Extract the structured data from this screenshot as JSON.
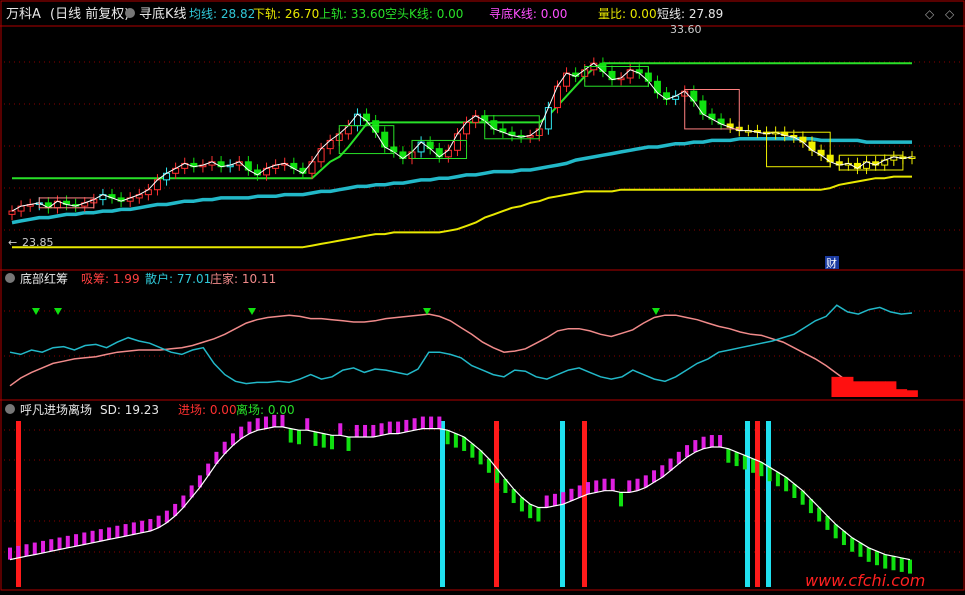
{
  "header": {
    "stock": "万科A",
    "mode": "(日线 前复权)",
    "indicator": "寻底K线",
    "avg_label": "均线: 28.82",
    "lower_label": "下轨: 26.70",
    "upper_label": "上轨: 33.60",
    "bear_label": "空头K线: 0.00",
    "find_label": "寻底K线: 0.00",
    "vol_ratio_label": "量比: 0.00",
    "short_label": "短线: 27.89",
    "high_marker": "33.60",
    "low_marker": "23.85",
    "cai_label": "财"
  },
  "panel2": {
    "title": "底部红筹",
    "absorb_label": "吸筹: 1.99",
    "retail_label": "散户: 77.01",
    "dealer_label": "庄家: 10.11"
  },
  "panel3": {
    "title": "呼凡进场离场",
    "sd_label": "SD: 19.23",
    "enter_label": "进场: 0.00",
    "leave_label": "离场: 0.00",
    "watermark": "www.cfchi.com"
  },
  "colors": {
    "frame": "#b00000",
    "ma_cyan": "#22b8c8",
    "green_line": "#28e028",
    "yellow_line": "#e8e800",
    "pink_line": "#f08a8a",
    "magenta_bar": "#e020e0",
    "green_bar": "#10e010",
    "red_signal": "#ff1a1a",
    "cyan_signal": "#20e0f0"
  },
  "chart_data": [
    {
      "type": "candlestick",
      "x": [
        1,
        2,
        3,
        4,
        5,
        6,
        7,
        8,
        9,
        10,
        11,
        12,
        13,
        14,
        15,
        16,
        17,
        18,
        19,
        20,
        21,
        22,
        23,
        24,
        25,
        26,
        27,
        28,
        29,
        30,
        31,
        32,
        33,
        34,
        35,
        36,
        37,
        38,
        39,
        40,
        41,
        42,
        43,
        44,
        45,
        46,
        47,
        48,
        49,
        50,
        51,
        52,
        53,
        54,
        55,
        56,
        57,
        58,
        59,
        60,
        61,
        62,
        63,
        64,
        65,
        66,
        67,
        68,
        69,
        70,
        71,
        72,
        73,
        74,
        75,
        76,
        77,
        78,
        79,
        80,
        81,
        82,
        83,
        84,
        85,
        86,
        87,
        88,
        89,
        90,
        91,
        92,
        93,
        94,
        95,
        96,
        97,
        98,
        99,
        100
      ],
      "close": [
        24.6,
        24.9,
        25.0,
        25.1,
        24.8,
        25.2,
        25.0,
        24.9,
        25.1,
        25.3,
        25.6,
        25.4,
        25.2,
        25.4,
        25.6,
        25.9,
        26.5,
        26.9,
        27.2,
        27.5,
        27.3,
        27.4,
        27.6,
        27.3,
        27.4,
        27.6,
        27.1,
        26.8,
        27.2,
        27.4,
        27.5,
        27.2,
        26.9,
        27.6,
        28.4,
        28.9,
        29.3,
        29.8,
        30.5,
        30.1,
        29.4,
        28.5,
        28.2,
        27.8,
        28.2,
        28.8,
        28.4,
        27.9,
        28.3,
        29.3,
        30.0,
        30.4,
        30.1,
        29.6,
        29.4,
        29.2,
        29.1,
        29.2,
        29.6,
        30.9,
        32.2,
        33.0,
        32.8,
        33.2,
        33.6,
        33.1,
        32.6,
        32.7,
        33.2,
        33.0,
        32.5,
        31.8,
        31.4,
        31.6,
        31.9,
        31.3,
        30.5,
        30.2,
        29.9,
        29.7,
        29.5,
        29.5,
        29.4,
        29.3,
        29.4,
        29.2,
        29.1,
        28.8,
        28.3,
        28.0,
        27.6,
        27.4,
        27.5,
        27.2,
        27.6,
        27.4,
        27.7,
        27.9,
        27.8,
        27.9
      ],
      "avg_line": [
        23.9,
        24.0,
        24.1,
        24.2,
        24.2,
        24.3,
        24.4,
        24.4,
        24.5,
        24.5,
        24.6,
        24.6,
        24.7,
        24.7,
        24.8,
        24.9,
        25.0,
        25.0,
        25.1,
        25.2,
        25.2,
        25.3,
        25.3,
        25.4,
        25.4,
        25.4,
        25.4,
        25.5,
        25.5,
        25.5,
        25.6,
        25.6,
        25.6,
        25.7,
        25.8,
        25.8,
        25.9,
        26.0,
        26.1,
        26.1,
        26.2,
        26.2,
        26.3,
        26.3,
        26.4,
        26.5,
        26.5,
        26.6,
        26.6,
        26.7,
        26.8,
        26.8,
        26.9,
        27.0,
        27.0,
        27.0,
        27.1,
        27.1,
        27.2,
        27.3,
        27.4,
        27.5,
        27.7,
        27.8,
        27.9,
        28.0,
        28.1,
        28.2,
        28.3,
        28.4,
        28.5,
        28.5,
        28.6,
        28.7,
        28.7,
        28.8,
        28.8,
        28.9,
        28.9,
        28.9,
        29.0,
        29.0,
        29.0,
        29.0,
        29.0,
        29.0,
        29.0,
        29.0,
        29.0,
        28.9,
        28.9,
        28.9,
        28.9,
        28.9,
        28.8,
        28.8,
        28.8,
        28.8,
        28.8,
        28.8
      ],
      "upper_line": [
        26.6,
        26.6,
        26.6,
        26.6,
        26.6,
        26.6,
        26.6,
        26.6,
        26.6,
        26.6,
        26.6,
        26.6,
        26.6,
        26.6,
        26.6,
        26.6,
        26.6,
        26.6,
        26.6,
        26.6,
        26.6,
        26.6,
        26.6,
        26.6,
        26.6,
        26.6,
        26.6,
        26.6,
        26.6,
        26.6,
        26.6,
        26.6,
        26.6,
        26.6,
        27.1,
        27.6,
        27.9,
        28.5,
        29.2,
        29.9,
        30.0,
        30.0,
        30.0,
        30.0,
        30.0,
        30.0,
        30.0,
        30.0,
        30.0,
        30.0,
        30.0,
        30.0,
        30.0,
        30.0,
        30.0,
        30.0,
        30.0,
        30.0,
        30.0,
        30.4,
        31.0,
        31.6,
        32.2,
        32.8,
        33.3,
        33.6,
        33.6,
        33.6,
        33.6,
        33.6,
        33.6,
        33.6,
        33.6,
        33.6,
        33.6,
        33.6,
        33.6,
        33.6,
        33.6,
        33.6,
        33.6,
        33.6,
        33.6,
        33.6,
        33.6,
        33.6,
        33.6,
        33.6,
        33.6,
        33.6,
        33.6,
        33.6,
        33.6,
        33.6,
        33.6,
        33.6,
        33.6,
        33.6,
        33.6,
        33.6
      ],
      "lower_line": [
        22.4,
        22.4,
        22.4,
        22.4,
        22.4,
        22.4,
        22.4,
        22.4,
        22.4,
        22.4,
        22.4,
        22.4,
        22.4,
        22.4,
        22.4,
        22.4,
        22.4,
        22.4,
        22.4,
        22.4,
        22.4,
        22.4,
        22.4,
        22.4,
        22.4,
        22.4,
        22.4,
        22.4,
        22.4,
        22.4,
        22.4,
        22.4,
        22.4,
        22.5,
        22.6,
        22.7,
        22.8,
        22.9,
        23.0,
        23.1,
        23.2,
        23.2,
        23.3,
        23.3,
        23.3,
        23.3,
        23.3,
        23.3,
        23.4,
        23.5,
        23.7,
        23.9,
        24.2,
        24.4,
        24.6,
        24.8,
        24.9,
        25.1,
        25.2,
        25.4,
        25.5,
        25.6,
        25.7,
        25.8,
        25.8,
        25.8,
        25.8,
        25.9,
        25.9,
        25.9,
        25.9,
        25.9,
        25.9,
        25.9,
        25.9,
        25.9,
        25.9,
        25.9,
        25.9,
        25.9,
        25.9,
        25.9,
        25.9,
        25.9,
        25.9,
        25.9,
        25.9,
        25.9,
        25.9,
        25.9,
        26.0,
        26.2,
        26.3,
        26.4,
        26.5,
        26.6,
        26.6,
        26.7,
        26.7,
        26.7
      ],
      "ylim": [
        21.5,
        35.5
      ]
    },
    {
      "type": "line",
      "series": [
        {
          "name": "吸筹",
          "values": [
            10,
            17,
            22,
            26,
            30,
            32,
            34,
            35,
            36,
            38,
            40,
            41,
            42,
            42,
            42,
            43,
            44,
            46,
            49,
            52,
            56,
            61,
            66,
            69,
            71,
            72,
            73,
            72,
            70,
            70,
            69,
            68,
            67,
            67,
            68,
            70,
            71,
            72,
            73,
            74,
            72,
            68,
            62,
            56,
            49,
            44,
            40,
            41,
            43,
            48,
            53,
            59,
            61,
            61,
            59,
            56,
            54,
            57,
            60,
            66,
            71,
            73,
            73,
            71,
            69,
            66,
            63,
            61,
            58,
            56,
            55,
            52,
            49,
            44,
            39,
            34,
            28,
            21,
            14,
            9,
            5,
            3,
            2,
            2,
            2
          ]
        },
        {
          "name": "散户",
          "values": [
            40,
            38,
            42,
            40,
            44,
            45,
            42,
            46,
            47,
            44,
            49,
            53,
            50,
            48,
            44,
            40,
            38,
            42,
            44,
            30,
            20,
            14,
            12,
            13,
            13,
            14,
            13,
            16,
            20,
            16,
            18,
            24,
            26,
            22,
            25,
            24,
            22,
            20,
            25,
            40,
            40,
            38,
            35,
            28,
            24,
            20,
            18,
            24,
            23,
            18,
            16,
            20,
            24,
            26,
            22,
            18,
            16,
            18,
            24,
            20,
            16,
            14,
            18,
            24,
            30,
            34,
            40,
            42,
            44,
            46,
            48,
            50,
            53,
            56,
            62,
            68,
            72,
            82,
            76,
            74,
            78,
            80,
            76,
            74,
            75
          ]
        },
        {
          "name": "庄家",
          "values": [
            0,
            0,
            0,
            0,
            0,
            0,
            0,
            0,
            0,
            0,
            0,
            0,
            0,
            0,
            0,
            0,
            0,
            0,
            0,
            0,
            0,
            0,
            0,
            0,
            0,
            0,
            0,
            0,
            0,
            0,
            0,
            0,
            0,
            0,
            0,
            0,
            0,
            0,
            0,
            0,
            0,
            0,
            0,
            0,
            0,
            0,
            0,
            0,
            0,
            0,
            0,
            0,
            0,
            0,
            0,
            0,
            0,
            0,
            0,
            0,
            0,
            0,
            0,
            0,
            0,
            0,
            0,
            0,
            0,
            0,
            0,
            0,
            0,
            0,
            0,
            0,
            0,
            18,
            18,
            14,
            14,
            14,
            14,
            7,
            6
          ]
        }
      ],
      "ylim": [
        0,
        100
      ]
    },
    {
      "type": "bar",
      "values": [
        5,
        6,
        7,
        8,
        9,
        10,
        11,
        12,
        13,
        14,
        15,
        16,
        17,
        18,
        19,
        20,
        21,
        22,
        24,
        27,
        31,
        36,
        42,
        48,
        55,
        62,
        68,
        73,
        77,
        80,
        82,
        83,
        84,
        84,
        83,
        82,
        82,
        81,
        80,
        79,
        79,
        78,
        78,
        78,
        78,
        79,
        80,
        80,
        81,
        82,
        83,
        83,
        83,
        82,
        80,
        78,
        74,
        70,
        65,
        59,
        53,
        47,
        42,
        38,
        36,
        36,
        37,
        38,
        40,
        42,
        44,
        45,
        46,
        46,
        45,
        45,
        46,
        48,
        51,
        54,
        58,
        62,
        66,
        69,
        71,
        72,
        72,
        71,
        69,
        67,
        65,
        63,
        60,
        57,
        54,
        50,
        46,
        41,
        36,
        31,
        26,
        22,
        18,
        15,
        12,
        10,
        8,
        7,
        6,
        5
      ],
      "colors_by_trend": [
        "magenta_up",
        "green_down"
      ],
      "ylim": [
        0,
        100
      ]
    }
  ]
}
